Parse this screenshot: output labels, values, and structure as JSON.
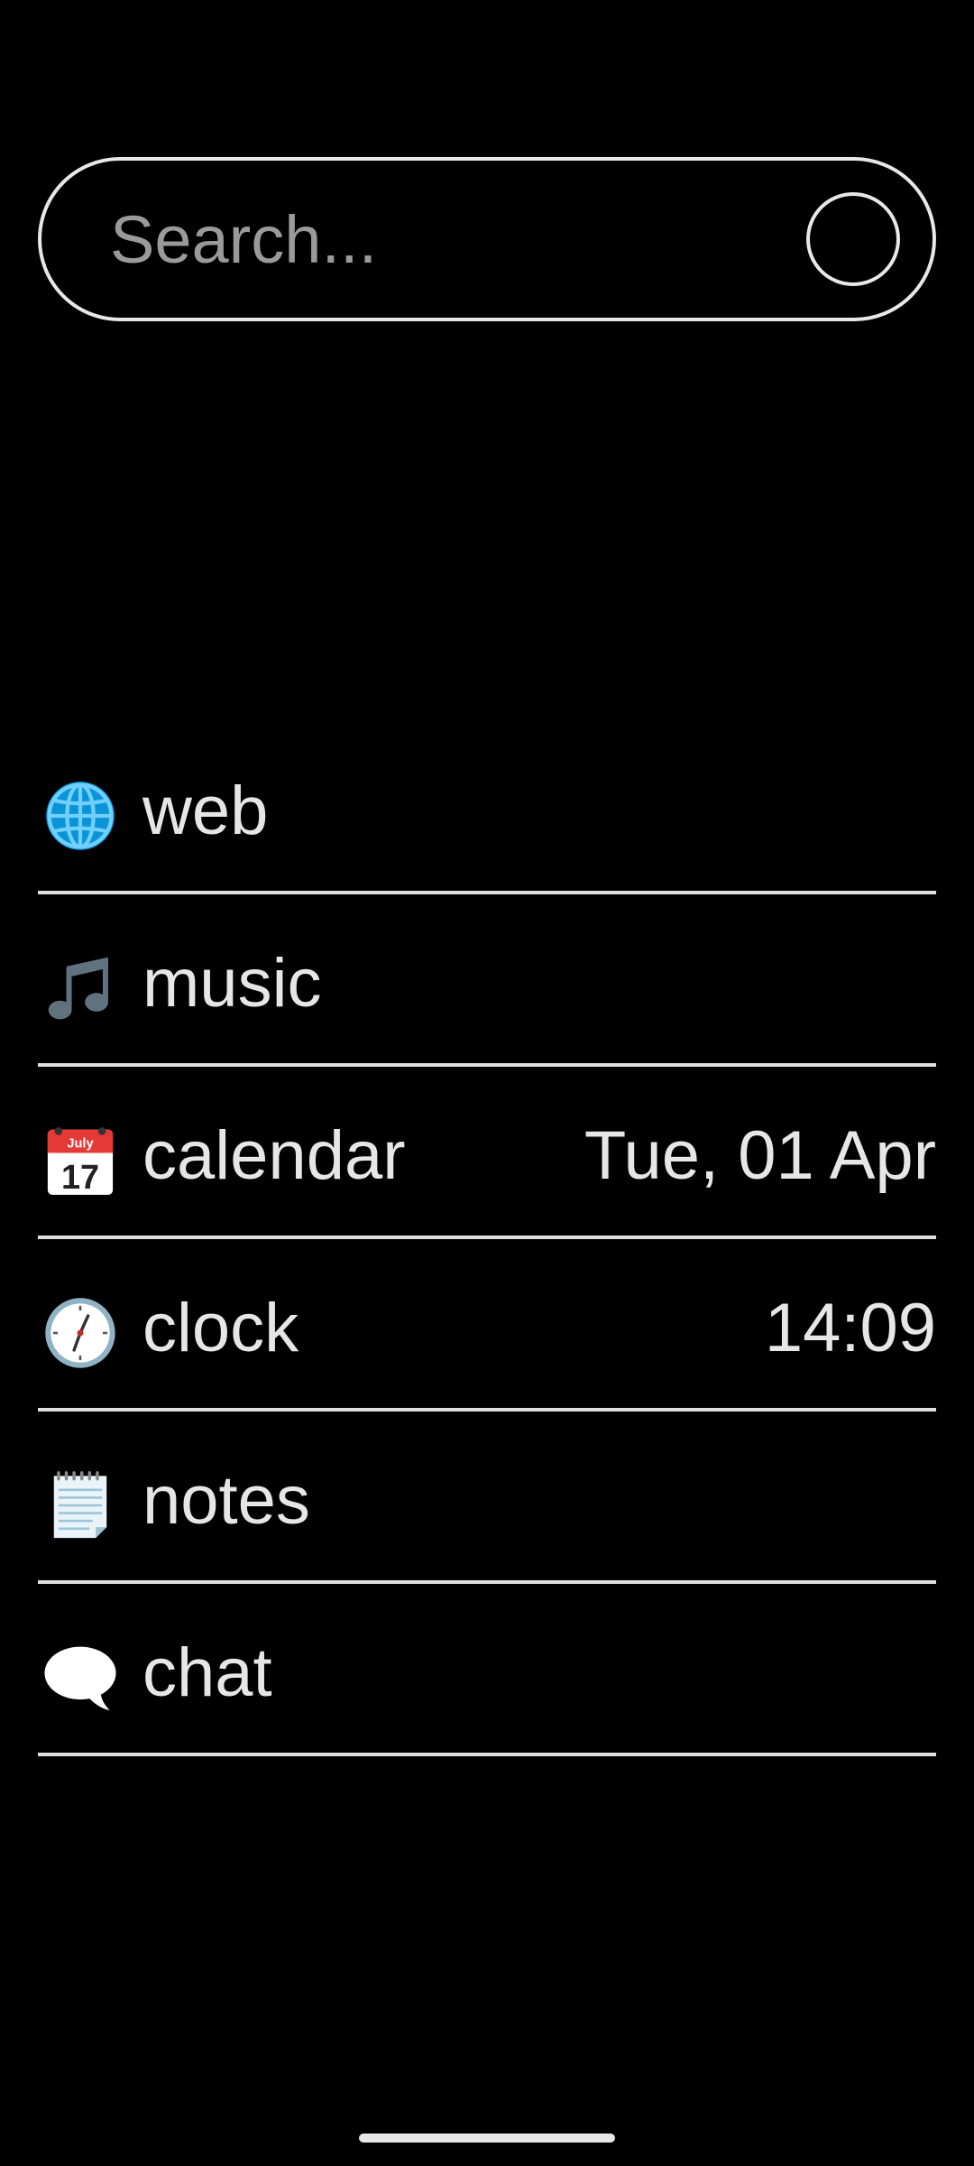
{
  "search": {
    "placeholder": "Search..."
  },
  "items": [
    {
      "icon": "globe-icon",
      "label": "web",
      "value": ""
    },
    {
      "icon": "music-note-icon",
      "label": "music",
      "value": ""
    },
    {
      "icon": "calendar-icon",
      "label": "calendar",
      "value": "Tue, 01 Apr",
      "icon_text_month": "July",
      "icon_text_day": "17"
    },
    {
      "icon": "clock-icon",
      "label": "clock",
      "value": "14:09"
    },
    {
      "icon": "notepad-icon",
      "label": "notes",
      "value": ""
    },
    {
      "icon": "speech-bubble-icon",
      "label": "chat",
      "value": ""
    }
  ],
  "colors": {
    "background": "#000000",
    "foreground": "#e6e6e6",
    "placeholder": "#9a9a9a",
    "divider": "#e0e0e0"
  }
}
